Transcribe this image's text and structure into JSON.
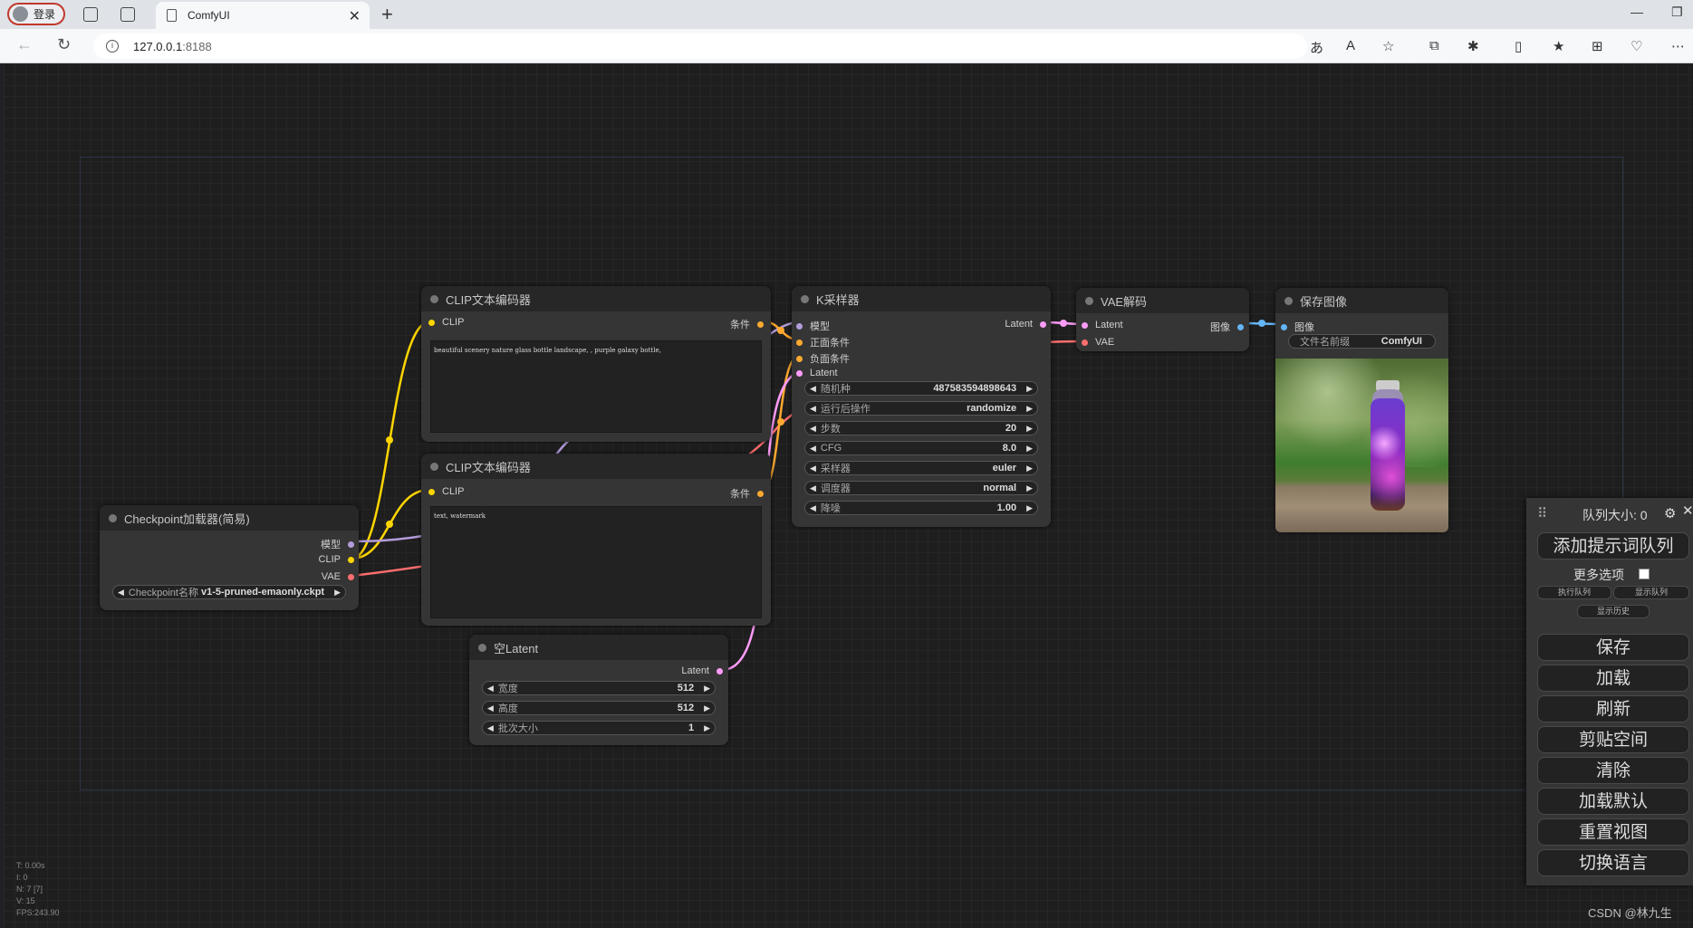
{
  "browser": {
    "login_label": "登录",
    "tab_title": "ComfyUI",
    "url_host": "127.0.0.1",
    "url_port": ":8188"
  },
  "nodes": {
    "clip_encoder_1": {
      "title": "CLIP文本编码器",
      "input_clip": "CLIP",
      "output": "条件",
      "text": "beautiful scenery nature glass bottle landscape, , purple galaxy bottle,"
    },
    "clip_encoder_2": {
      "title": "CLIP文本编码器",
      "input_clip": "CLIP",
      "output": "条件",
      "text": "text, watermark"
    },
    "checkpoint": {
      "title": "Checkpoint加载器(简易)",
      "out_model": "模型",
      "out_clip": "CLIP",
      "out_vae": "VAE",
      "widget_label": "Checkpoint名称",
      "widget_value": "v1-5-pruned-emaonly.ckpt"
    },
    "ksampler": {
      "title": "K采样器",
      "in_model": "模型",
      "in_positive": "正面条件",
      "in_negative": "负面条件",
      "in_latent": "Latent",
      "output": "Latent",
      "widgets": [
        {
          "label": "随机种",
          "value": "487583594898643"
        },
        {
          "label": "运行后操作",
          "value": "randomize"
        },
        {
          "label": "步数",
          "value": "20"
        },
        {
          "label": "CFG",
          "value": "8.0"
        },
        {
          "label": "采样器",
          "value": "euler"
        },
        {
          "label": "调度器",
          "value": "normal"
        },
        {
          "label": "降噪",
          "value": "1.00"
        }
      ]
    },
    "vae_decode": {
      "title": "VAE解码",
      "in_latent": "Latent",
      "in_vae": "VAE",
      "output": "图像"
    },
    "save_image": {
      "title": "保存图像",
      "in_image": "图像",
      "widget_label": "文件名前缀",
      "widget_value": "ComfyUI"
    },
    "empty_latent": {
      "title": "空Latent",
      "output": "Latent",
      "widgets": [
        {
          "label": "宽度",
          "value": "512"
        },
        {
          "label": "高度",
          "value": "512"
        },
        {
          "label": "批次大小",
          "value": "1"
        }
      ]
    }
  },
  "queue_panel": {
    "queue_size": "队列大小: 0",
    "queue_prompt": "添加提示词队列",
    "more_options": "更多选项",
    "exec_queue": "执行队列",
    "show_queue": "显示队列",
    "show_history": "显示历史",
    "buttons": [
      "保存",
      "加载",
      "刷新",
      "剪贴空间",
      "清除",
      "加载默认",
      "重置视图",
      "切换语言"
    ]
  },
  "stats": [
    "T: 0.00s",
    "I: 0",
    "N: 7 [7]",
    "V: 15",
    "FPS:243.90"
  ],
  "watermark": "CSDN @林九生",
  "colors": {
    "clip": "#ffd500",
    "model": "#b39ddb",
    "vae": "#ff6e6e",
    "conditioning": "#ffa931",
    "latent": "#ff9cf9",
    "image": "#64b5f6"
  }
}
